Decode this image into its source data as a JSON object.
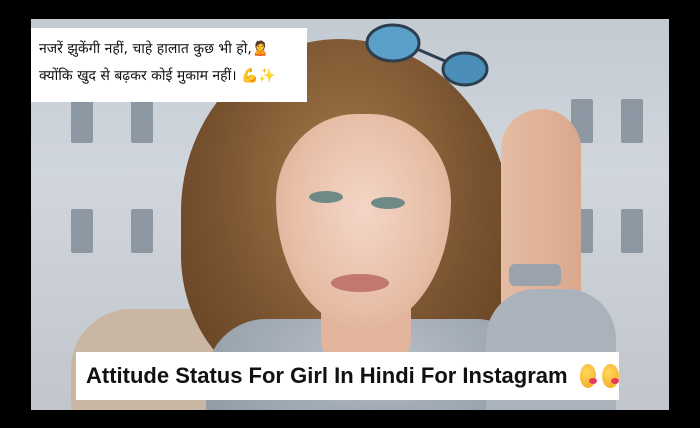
{
  "caption_top": {
    "line1": "नजरें झुकेंगी नहीं, चाहे हालात कुछ भी हो,🙎",
    "line2": "क्योंकि खुद से बढ़कर कोई मुकाम नहीं। 💪✨"
  },
  "caption_bottom": {
    "title": "Attitude Status For Girl In Hindi For Instagram",
    "emoji_1": "kissing-face-icon",
    "emoji_2": "kissing-face-icon"
  },
  "colors": {
    "frame": "#000000",
    "caption_bg": "#ffffff",
    "text": "#111111"
  }
}
